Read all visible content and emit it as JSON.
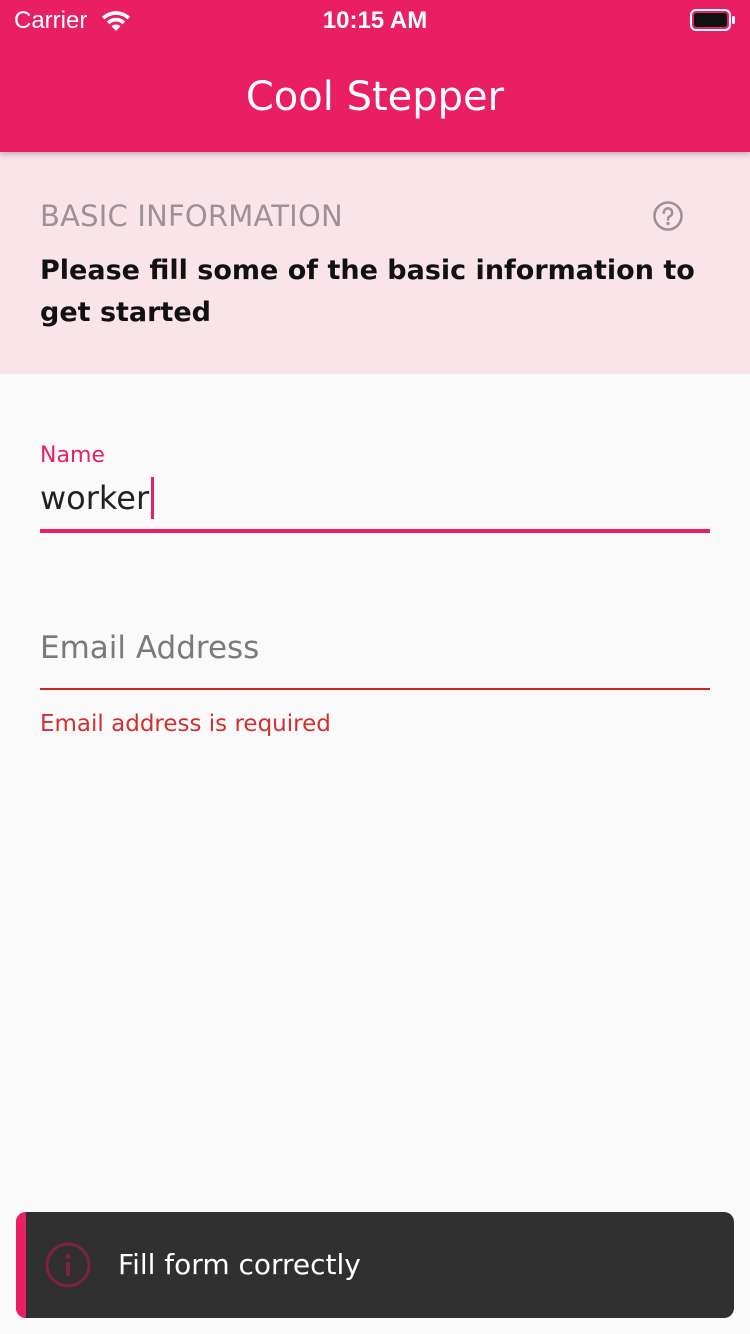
{
  "status_bar": {
    "carrier": "Carrier",
    "time": "10:15 AM",
    "icons": [
      "wifi-icon",
      "battery-icon"
    ]
  },
  "app_bar": {
    "title": "Cool Stepper",
    "color": "#e91e63"
  },
  "step": {
    "title": "BASIC INFORMATION",
    "subtitle": "Please fill some of the basic information to get started",
    "help_icon": "help-circle-icon",
    "header_background": "#f9e4ea"
  },
  "form": {
    "name_field": {
      "label": "Name",
      "value": "worker"
    },
    "email_field": {
      "placeholder": "Email Address",
      "value": "",
      "error": "Email address is required",
      "error_color": "#d32f2f"
    }
  },
  "snackbar": {
    "message": "Fill form correctly",
    "icon": "info-icon",
    "background": "#303030",
    "accent": "#e91e63"
  }
}
